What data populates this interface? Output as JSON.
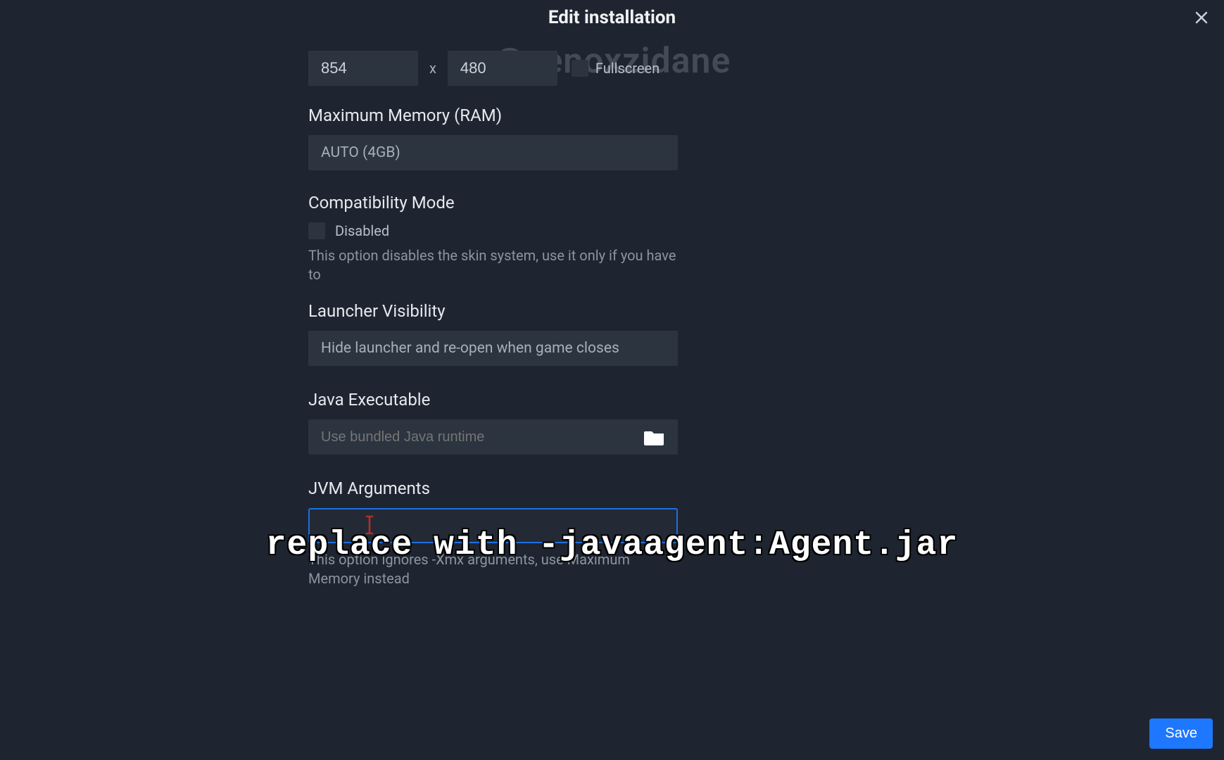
{
  "modal": {
    "title": "Edit installation",
    "close_aria": "Close"
  },
  "watermark": "@zenoxzidane",
  "resolution": {
    "width": "854",
    "height": "480",
    "sep": "x",
    "fullscreen_label": "Fullscreen",
    "fullscreen_checked": false
  },
  "memory": {
    "label": "Maximum Memory (RAM)",
    "value": "AUTO (4GB)"
  },
  "compat": {
    "label": "Compatibility Mode",
    "checkbox_label": "Disabled",
    "checked": false,
    "helper": "This option disables the skin system, use it only if you have to"
  },
  "launcher_visibility": {
    "label": "Launcher Visibility",
    "value": "Hide launcher and re-open when game closes"
  },
  "java_exec": {
    "label": "Java Executable",
    "placeholder": "Use bundled Java runtime",
    "value": ""
  },
  "jvm_args": {
    "label": "JVM Arguments",
    "value": "",
    "helper": "This option ignores -Xmx arguments, use Maximum Memory instead"
  },
  "caption": "replace with -javaagent:Agent.jar",
  "buttons": {
    "save": "Save"
  }
}
